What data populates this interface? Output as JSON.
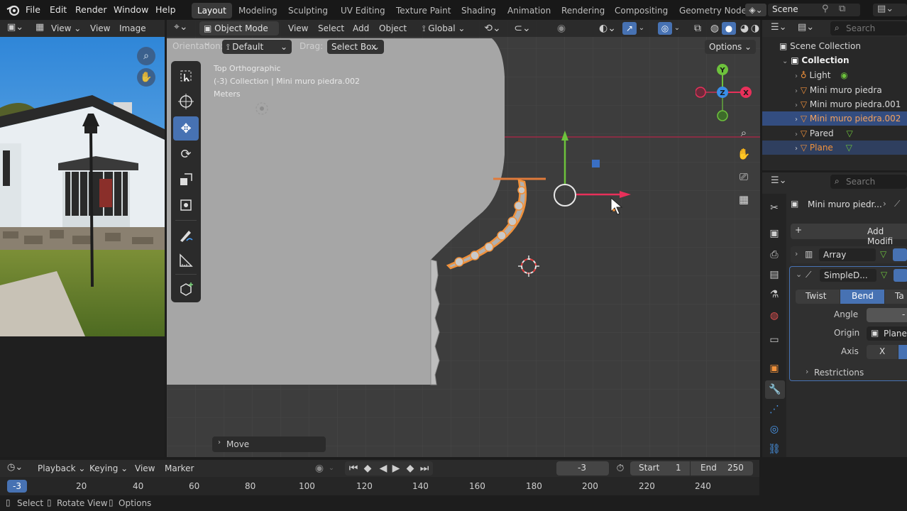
{
  "menubar": {
    "items": [
      "File",
      "Edit",
      "Render",
      "Window",
      "Help"
    ],
    "workspaces": [
      "Layout",
      "Modeling",
      "Sculpting",
      "UV Editing",
      "Texture Paint",
      "Shading",
      "Animation",
      "Rendering",
      "Compositing",
      "Geometry Node"
    ],
    "active_workspace": "Layout",
    "scene_name": "Scene"
  },
  "image_editor": {
    "menu": [
      "View",
      "View",
      "Image"
    ]
  },
  "viewport": {
    "mode": "Object Mode",
    "menu": [
      "View",
      "Select",
      "Add",
      "Object"
    ],
    "transform_orientation": "Global",
    "orientation_label": "Orientation:",
    "orientation_value": "Default",
    "drag_label": "Drag:",
    "drag_value": "Select Box",
    "options_label": "Options",
    "overlay_line1": "Top Orthographic",
    "overlay_line2": "(-3) Collection | Mini muro piedra.002",
    "overlay_line3": "Meters",
    "last_op": "Move",
    "gizmo_axes": [
      "X",
      "Y",
      "Z"
    ]
  },
  "outliner": {
    "search_placeholder": "Search",
    "root": "Scene Collection",
    "collection": "Collection",
    "items": [
      {
        "name": "Light",
        "selected": false
      },
      {
        "name": "Mini muro piedra",
        "selected": false
      },
      {
        "name": "Mini muro piedra.001",
        "selected": false
      },
      {
        "name": "Mini muro piedra.002",
        "selected": true
      },
      {
        "name": "Pared",
        "selected": false
      },
      {
        "name": "Plane",
        "selected": false
      }
    ]
  },
  "properties": {
    "search_placeholder": "Search",
    "object_name": "Mini muro piedr...",
    "add_modifier": "Add Modifi",
    "modifiers": [
      "Array",
      "SimpleD..."
    ],
    "deform_tabs": [
      "Twist",
      "Bend",
      "Ta"
    ],
    "active_deform_tab": "Bend",
    "angle_label": "Angle",
    "angle_value": "-",
    "origin_label": "Origin",
    "origin_value": "Plane",
    "axis_label": "Axis",
    "axis_value": "X",
    "restrictions_label": "Restrictions"
  },
  "timeline": {
    "menu": [
      "Playback",
      "Keying",
      "View",
      "Marker"
    ],
    "current_frame": "-3",
    "start_label": "Start",
    "start_value": "1",
    "end_label": "End",
    "end_value": "250",
    "ruler": [
      "-3",
      "20",
      "40",
      "60",
      "80",
      "100",
      "120",
      "140",
      "160",
      "180",
      "200",
      "220",
      "240"
    ]
  },
  "statusbar": {
    "items": [
      "Select",
      "Rotate View",
      "Options"
    ]
  },
  "colors": {
    "accent": "#4772b3",
    "selected_orange": "#f0913b",
    "axis_x": "#e8305a",
    "axis_y": "#6dc23c",
    "axis_z": "#3a8fe8"
  }
}
